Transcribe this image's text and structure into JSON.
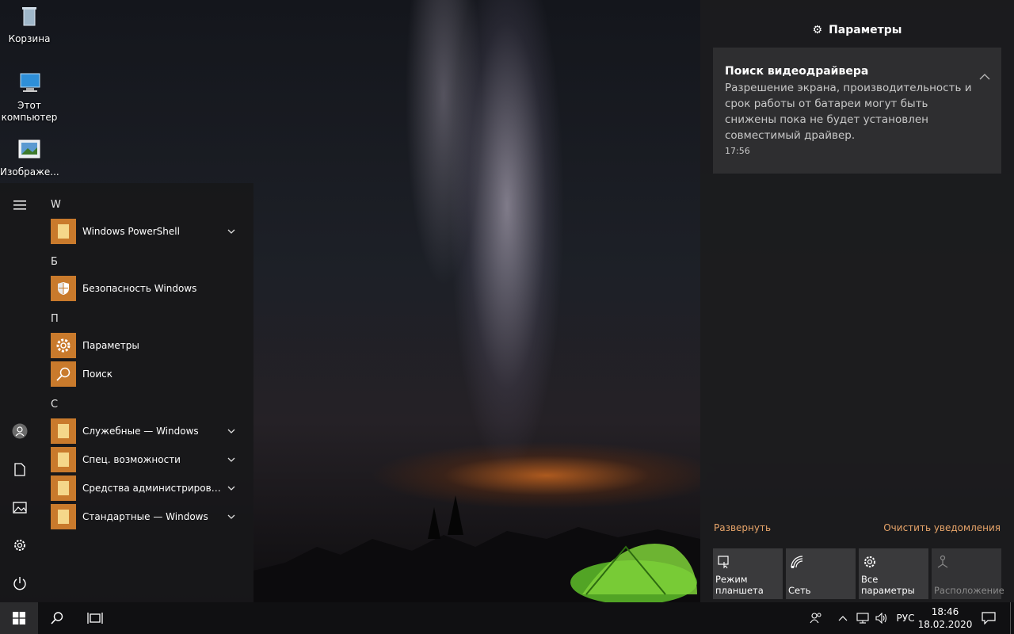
{
  "desktop": {
    "icons": [
      {
        "label": "Корзина"
      },
      {
        "label": "Этот компьютер"
      },
      {
        "label": "Изображе..."
      }
    ]
  },
  "start_menu": {
    "sections": [
      {
        "letter": "W",
        "apps": [
          {
            "label": "Windows PowerShell",
            "expandable": true,
            "icon": "folder-icon"
          }
        ]
      },
      {
        "letter": "Б",
        "apps": [
          {
            "label": "Безопасность Windows",
            "expandable": false,
            "icon": "shield-icon"
          }
        ]
      },
      {
        "letter": "П",
        "apps": [
          {
            "label": "Параметры",
            "expandable": false,
            "icon": "gear-icon"
          },
          {
            "label": "Поиск",
            "expandable": false,
            "icon": "search-icon"
          }
        ]
      },
      {
        "letter": "С",
        "apps": [
          {
            "label": "Служебные — Windows",
            "expandable": true,
            "icon": "folder-icon"
          },
          {
            "label": "Спец. возможности",
            "expandable": true,
            "icon": "folder-icon"
          },
          {
            "label": "Средства администрирования...",
            "expandable": true,
            "icon": "folder-icon"
          },
          {
            "label": "Стандартные — Windows",
            "expandable": true,
            "icon": "folder-icon"
          }
        ]
      }
    ],
    "rail_icons": [
      "hamburger-icon",
      "user-icon",
      "documents-icon",
      "pictures-icon",
      "settings-icon",
      "power-icon"
    ]
  },
  "action_center": {
    "title": "Параметры",
    "notification": {
      "title": "Поиск видеодрайвера",
      "body": "Разрешение экрана, производительность и срок работы от батареи могут быть снижены пока не будет установлен совместимый драйвер.",
      "time": "17:56"
    },
    "expand_label": "Развернуть",
    "clear_label": "Очистить уведомления",
    "quick_actions": [
      {
        "label": "Режим планшета",
        "icon": "tablet-mode-icon",
        "enabled": true
      },
      {
        "label": "Сеть",
        "icon": "network-icon",
        "enabled": true
      },
      {
        "label": "Все параметры",
        "icon": "settings-icon",
        "enabled": true
      },
      {
        "label": "Расположение",
        "icon": "location-icon",
        "enabled": false
      }
    ]
  },
  "taskbar": {
    "language": "РУС",
    "time": "18:46",
    "date": "18.02.2020"
  },
  "colors": {
    "tile": "#c97a2c",
    "link": "#e8a56a",
    "taskbar": "#101012"
  }
}
